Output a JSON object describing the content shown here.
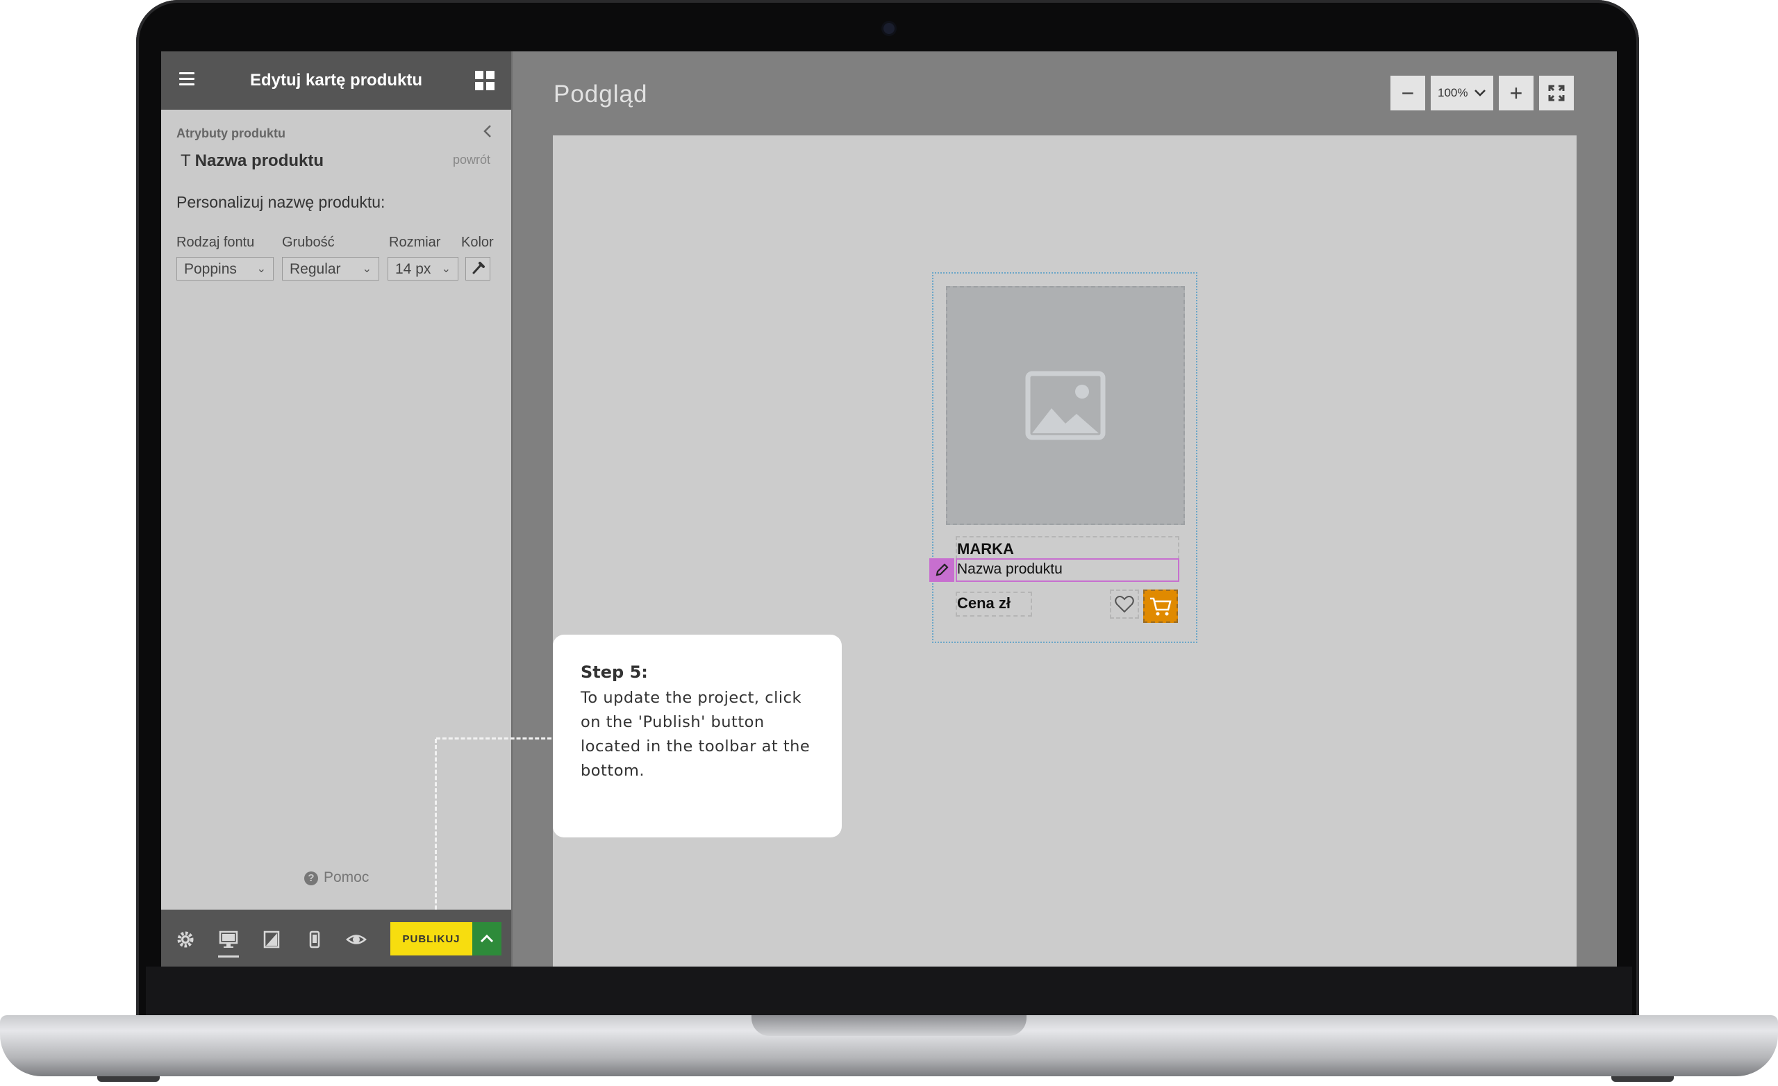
{
  "panel": {
    "title": "Edytuj kartę produktu",
    "breadcrumb": "Atrybuty produktu",
    "attribute_name": "Nazwa produktu",
    "attribute_icon": "T",
    "back_link": "powrót",
    "section_label": "Personalizuj nazwę produktu:",
    "fields": {
      "font_label": "Rodzaj fontu",
      "font_value": "Poppins",
      "weight_label": "Grubość",
      "weight_value": "Regular",
      "size_label": "Rozmiar",
      "size_value": "14 px",
      "color_label": "Kolor"
    },
    "help_label": "Pomoc",
    "publish_label": "PUBLIKUJ"
  },
  "preview": {
    "title": "Podgląd",
    "zoom_value": "100%",
    "zoom_out_label": "−",
    "zoom_in_label": "+",
    "card": {
      "brand": "MARKA",
      "product_name": "Nazwa produktu",
      "price": "Cena zł"
    }
  },
  "tip": {
    "heading": "Step 5:",
    "body": "To update the project, click on the 'Publish' button located in the toolbar at the bottom."
  },
  "colors": {
    "accent_publish": "#f7dd0f",
    "expand_button": "#2e8b3a",
    "cart_button": "#e08a00",
    "selection_highlight": "#c76fcf",
    "header_bg": "#555555"
  },
  "icons": [
    "menu-icon",
    "grid-icon",
    "chevron-left-icon",
    "text-icon",
    "eyedropper-icon",
    "help-icon",
    "settings-icon",
    "desktop-icon",
    "tablet-icon",
    "mobile-icon",
    "eye-icon",
    "chevron-up-icon",
    "zoom-out-icon",
    "zoom-in-icon",
    "fullscreen-icon",
    "image-placeholder-icon",
    "pencil-icon",
    "heart-icon",
    "cart-icon"
  ]
}
